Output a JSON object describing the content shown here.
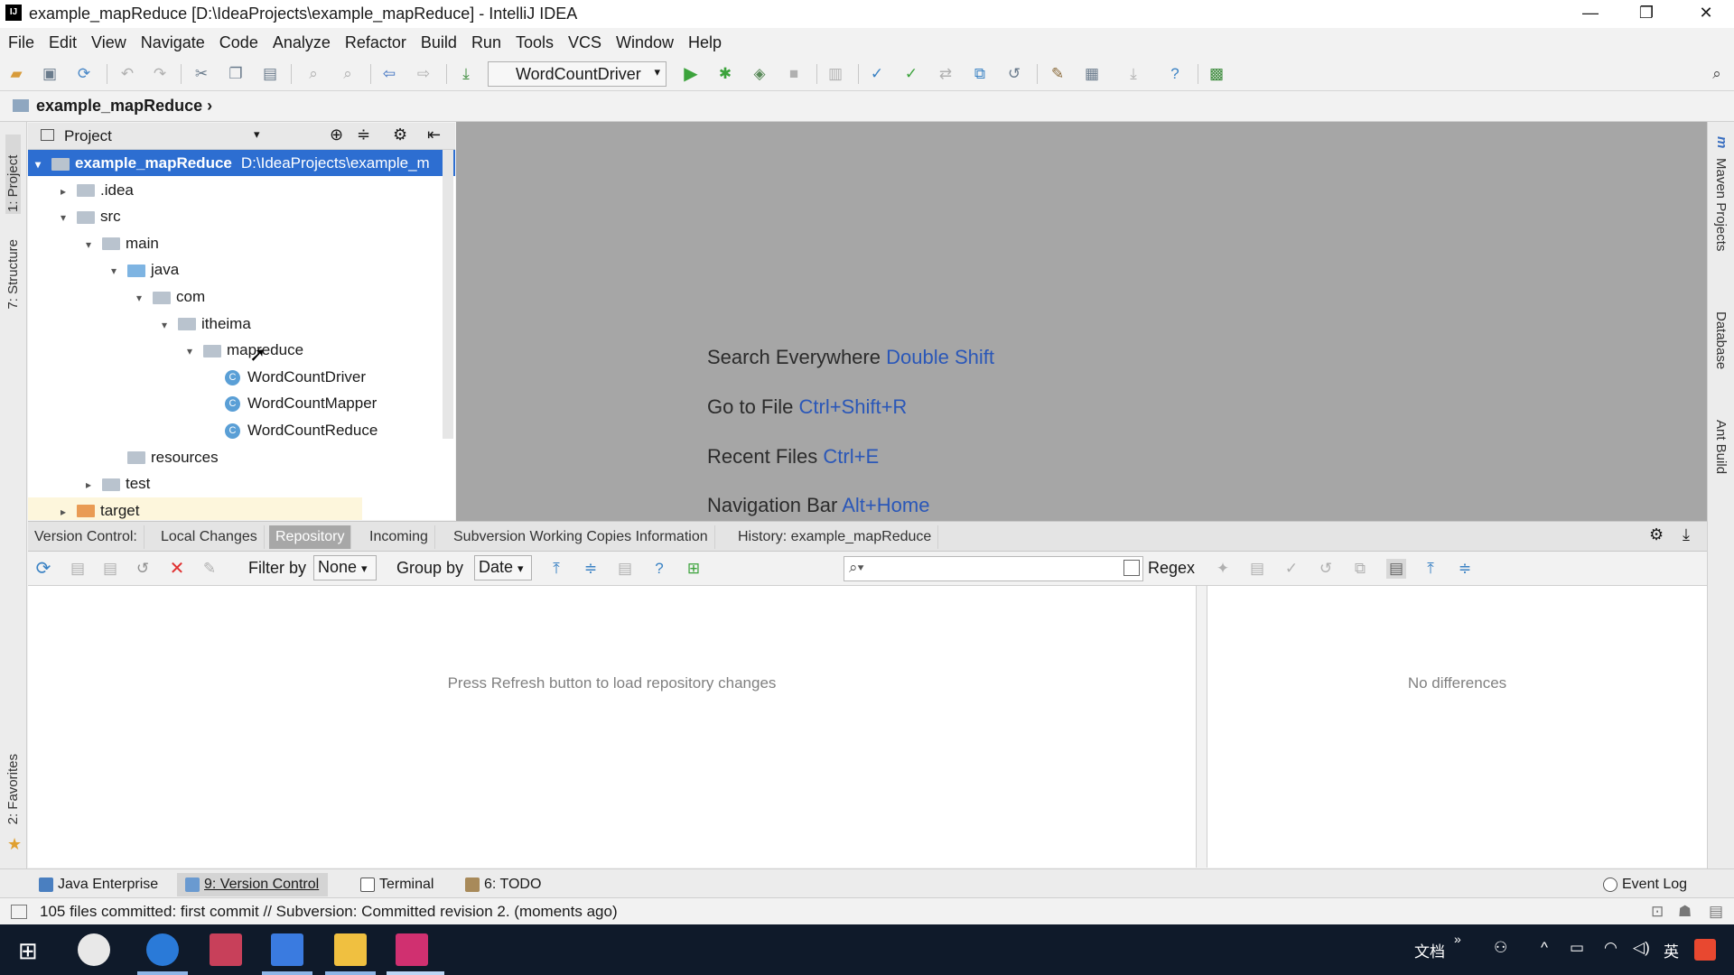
{
  "window": {
    "title": "example_mapReduce [D:\\IdeaProjects\\example_mapReduce] - IntelliJ IDEA",
    "logo": "IJ",
    "minimize": "—",
    "restore": "❐",
    "close": "✕"
  },
  "menu": [
    "File",
    "Edit",
    "View",
    "Navigate",
    "Code",
    "Analyze",
    "Refactor",
    "Build",
    "Run",
    "Tools",
    "VCS",
    "Window",
    "Help"
  ],
  "toolbar": {
    "run_config": "WordCountDriver"
  },
  "navbar": {
    "project": "example_mapReduce"
  },
  "sidebar": {
    "left": [
      "1: Project",
      "7: Structure",
      "2: Favorites"
    ],
    "right": [
      "Maven Projects",
      "Database",
      "Ant Build"
    ]
  },
  "project_panel": {
    "title": "Project",
    "tree": [
      {
        "label": "example_mapReduce",
        "path": "D:\\IdeaProjects\\example_m",
        "depth": 0,
        "expanded": true,
        "kind": "module"
      },
      {
        "label": ".idea",
        "depth": 1,
        "expanded": false,
        "kind": "folder"
      },
      {
        "label": "src",
        "depth": 1,
        "expanded": true,
        "kind": "folder"
      },
      {
        "label": "main",
        "depth": 2,
        "expanded": true,
        "kind": "folder"
      },
      {
        "label": "java",
        "depth": 3,
        "expanded": true,
        "kind": "source"
      },
      {
        "label": "com",
        "depth": 4,
        "expanded": true,
        "kind": "folder"
      },
      {
        "label": "itheima",
        "depth": 5,
        "expanded": true,
        "kind": "folder"
      },
      {
        "label": "mapreduce",
        "depth": 6,
        "expanded": true,
        "kind": "folder"
      },
      {
        "label": "WordCountDriver",
        "depth": 7,
        "kind": "class"
      },
      {
        "label": "WordCountMapper",
        "depth": 7,
        "kind": "class"
      },
      {
        "label": "WordCountReduce",
        "depth": 7,
        "kind": "class"
      },
      {
        "label": "resources",
        "depth": 3,
        "kind": "folder"
      },
      {
        "label": "test",
        "depth": 2,
        "expanded": false,
        "kind": "folder"
      },
      {
        "label": "target",
        "depth": 1,
        "expanded": false,
        "kind": "excluded"
      }
    ]
  },
  "editor": {
    "hints": [
      {
        "text": "Search Everywhere",
        "key": "Double Shift"
      },
      {
        "text": "Go to File",
        "key": "Ctrl+Shift+R"
      },
      {
        "text": "Recent Files",
        "key": "Ctrl+E"
      },
      {
        "text": "Navigation Bar",
        "key": "Alt+Home"
      }
    ]
  },
  "version_control": {
    "label": "Version Control:",
    "tabs": [
      "Local Changes",
      "Repository",
      "Incoming",
      "Subversion Working Copies Information",
      "History: example_mapReduce"
    ],
    "active_tab": "Repository",
    "filter_label": "Filter by",
    "filter_value": "None",
    "group_label": "Group by",
    "group_value": "Date",
    "regex_label": "Regex",
    "left_empty": "Press Refresh button to load repository changes",
    "right_empty": "No differences"
  },
  "bottom_tabs": [
    {
      "label": "Java Enterprise"
    },
    {
      "label": "9: Version Control"
    },
    {
      "label": "Terminal"
    },
    {
      "label": "6: TODO"
    }
  ],
  "event_log": "Event Log",
  "status": "105 files committed: first commit // Subversion: Committed revision 2. (moments ago)",
  "taskbar": {
    "tray_text": "文档",
    "ime": "英"
  },
  "colors": {
    "selection": "#2d6ed1",
    "shortcut": "#2a57b8",
    "editor_bg": "#a6a6a6"
  }
}
